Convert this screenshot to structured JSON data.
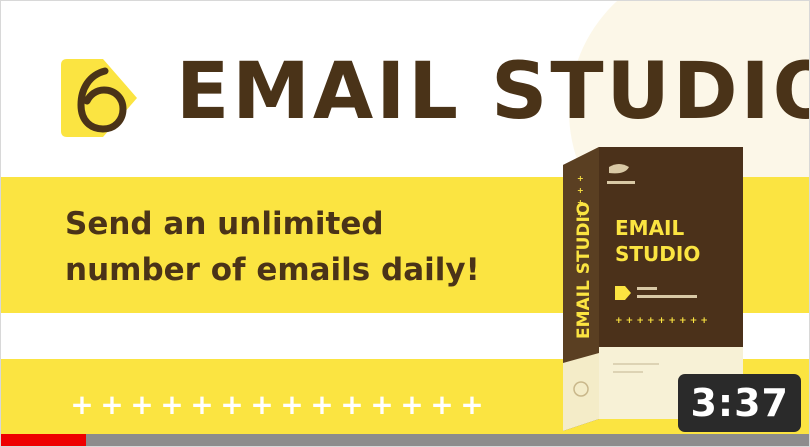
{
  "brand": {
    "logo_icon": "digit-6-in-yellow-play-shape-icon",
    "title": "EMAIL STUDIO"
  },
  "tagline": {
    "line1": "Send an unlimited",
    "line2": "number of emails daily!"
  },
  "product_box": {
    "spine_text": "EMAIL STUDIO",
    "front_title_line1": "EMAIL",
    "front_title_line2": "STUDIO"
  },
  "decoration": {
    "plus_glyph": "+",
    "plus_count": 14
  },
  "video": {
    "duration": "3:37",
    "watched_fraction": 0.105
  },
  "colors": {
    "brand_brown": "#4a3318",
    "brand_yellow": "#fbe441",
    "progress_red": "#ee0000",
    "badge_bg": "#2a2a2a"
  }
}
